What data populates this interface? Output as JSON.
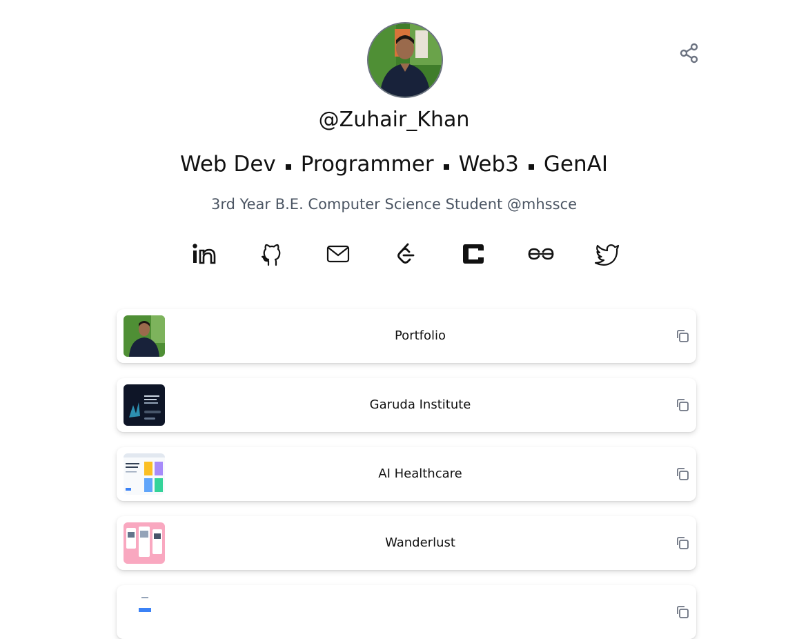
{
  "profile": {
    "username": "@Zuhair_Khan",
    "roles": [
      "Web Dev",
      "Programmer",
      "Web3",
      "GenAI"
    ],
    "bio": "3rd Year B.E. Computer Science Student @mhssce"
  },
  "socials": [
    {
      "name": "linkedin-icon"
    },
    {
      "name": "github-icon"
    },
    {
      "name": "mail-icon"
    },
    {
      "name": "leetcode-icon"
    },
    {
      "name": "codechef-icon"
    },
    {
      "name": "geeksforgeeks-icon"
    },
    {
      "name": "twitter-icon"
    }
  ],
  "links": [
    {
      "title": "Portfolio",
      "thumb": "profile-photo"
    },
    {
      "title": "Garuda Institute",
      "thumb": "dark-site-preview"
    },
    {
      "title": "AI Healthcare",
      "thumb": "light-site-preview"
    },
    {
      "title": "Wanderlust",
      "thumb": "pink-app-preview"
    },
    {
      "title": "",
      "thumb": "partial-preview"
    }
  ],
  "icons": {
    "share": "share-icon",
    "copy": "copy-icon"
  },
  "colors": {
    "background": "#ffffff",
    "text": "#111111",
    "muted": "#4b5563",
    "icon": "#6b7280"
  }
}
